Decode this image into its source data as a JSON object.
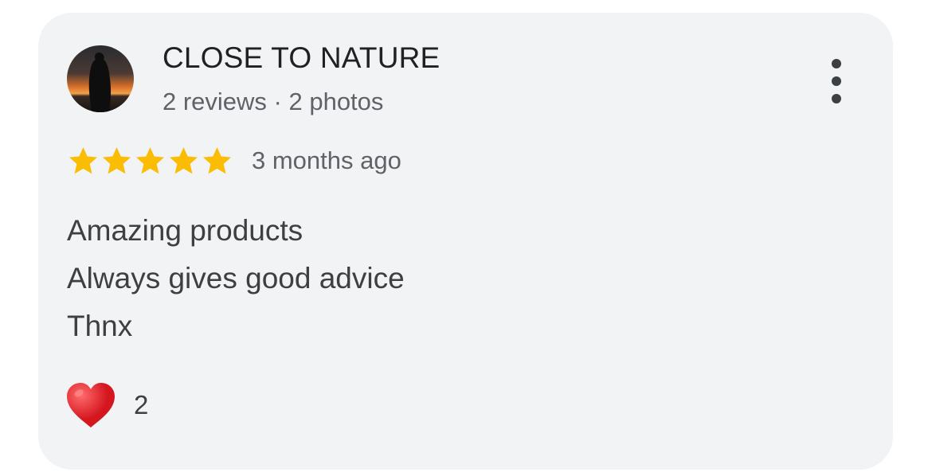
{
  "review": {
    "author_name": "CLOSE TO NATURE",
    "author_meta": "2 reviews · 2 photos",
    "rating": 5,
    "rating_max": 5,
    "time": "3 months ago",
    "text_lines": [
      "Amazing products",
      "Always gives good advice",
      "Thnx"
    ],
    "reactions": {
      "icon": "heart-icon",
      "count": "2"
    }
  },
  "icons": {
    "more": "more-vert-icon",
    "star": "star-icon",
    "avatar": "avatar-silhouette-sunset"
  },
  "colors": {
    "card_background": "#f2f3f5",
    "star": "#fbbc04",
    "heart": "#e0242c",
    "primary_text": "#202124",
    "secondary_text": "#5f6368"
  }
}
